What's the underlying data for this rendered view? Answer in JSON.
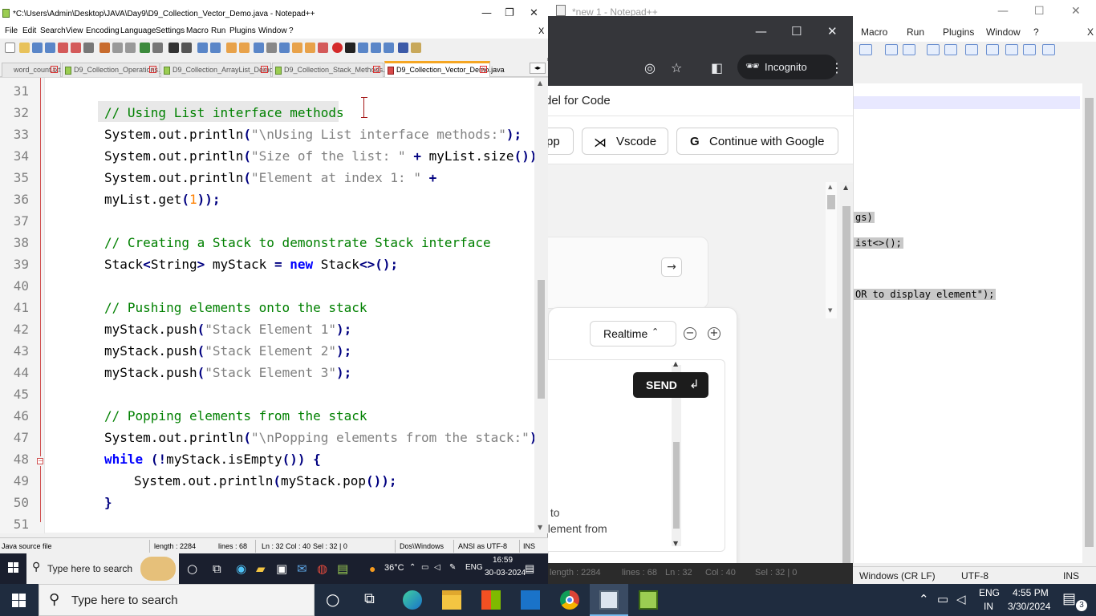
{
  "bg_notepad": {
    "title": "*new 1 - Notepad++",
    "menu": [
      "Macro",
      "Run",
      "Plugins",
      "Window",
      "?"
    ],
    "close_x": "X",
    "code_fragments": [
      "gs)",
      "ist<>();",
      "OR to display element\");"
    ],
    "status": [
      "Windows (CR LF)",
      "UTF-8",
      "INS"
    ]
  },
  "chrome": {
    "mode_label": "Incognito",
    "header_text": "del for Code",
    "buttons": [
      "pp",
      "Vscode",
      "Continue with Google"
    ],
    "mode_select": "Realtime",
    "send_label": "SEND",
    "send_glyph": "↲",
    "textarea_text_1": "k to",
    "textarea_text_2": "element  from",
    "arrow_glyph": "→"
  },
  "midstrip_text": [
    "length : 2284",
    "lines : 68",
    "Ln : 32",
    "Col : 40",
    "Sel : 32 | 0"
  ],
  "notepad": {
    "title": "*C:\\Users\\Admin\\Desktop\\JAVA\\Day9\\D9_Collection_Vector_Demo.java - Notepad++",
    "menu": [
      "File",
      "Edit",
      "Search",
      "View",
      "Encoding",
      "Language",
      "Settings",
      "Macro",
      "Run",
      "Plugins",
      "Window",
      "?"
    ],
    "menu_close": "X",
    "tabs": [
      {
        "label": "word_count.txt",
        "active": false
      },
      {
        "label": "D9_Collection_Operations.java",
        "active": false
      },
      {
        "label": "D9_Collection_ArrayList_Demo.java",
        "active": false
      },
      {
        "label": "D9_Collection_Stack_Methods.java",
        "active": false
      },
      {
        "label": "D9_Collection_Vector_Demo.java",
        "active": true
      }
    ],
    "line_numbers": [
      "31",
      "32",
      "33",
      "34",
      "35",
      "36",
      "37",
      "38",
      "39",
      "40",
      "41",
      "42",
      "43",
      "44",
      "45",
      "46",
      "47",
      "48",
      "49",
      "50",
      "51"
    ],
    "status": {
      "file_type": "Java source file",
      "length": "length : 2284",
      "lines": "lines : 68",
      "ln": "Ln : 32",
      "col": "Col : 40",
      "sel": "Sel : 32 | 0",
      "eol": "Dos\\Windows",
      "encoding": "ANSI as UTF-8",
      "mode": "INS"
    }
  },
  "inner_taskbar": {
    "search_placeholder": "Type here to search",
    "weather": "36°C",
    "lang": "ENG",
    "time": "16:59",
    "date": "30-03-2024"
  },
  "taskbar": {
    "search_placeholder": "Type here to search",
    "lang_top": "ENG",
    "lang_bottom": "IN",
    "time": "4:55 PM",
    "date": "3/30/2024",
    "notifications": "3"
  }
}
